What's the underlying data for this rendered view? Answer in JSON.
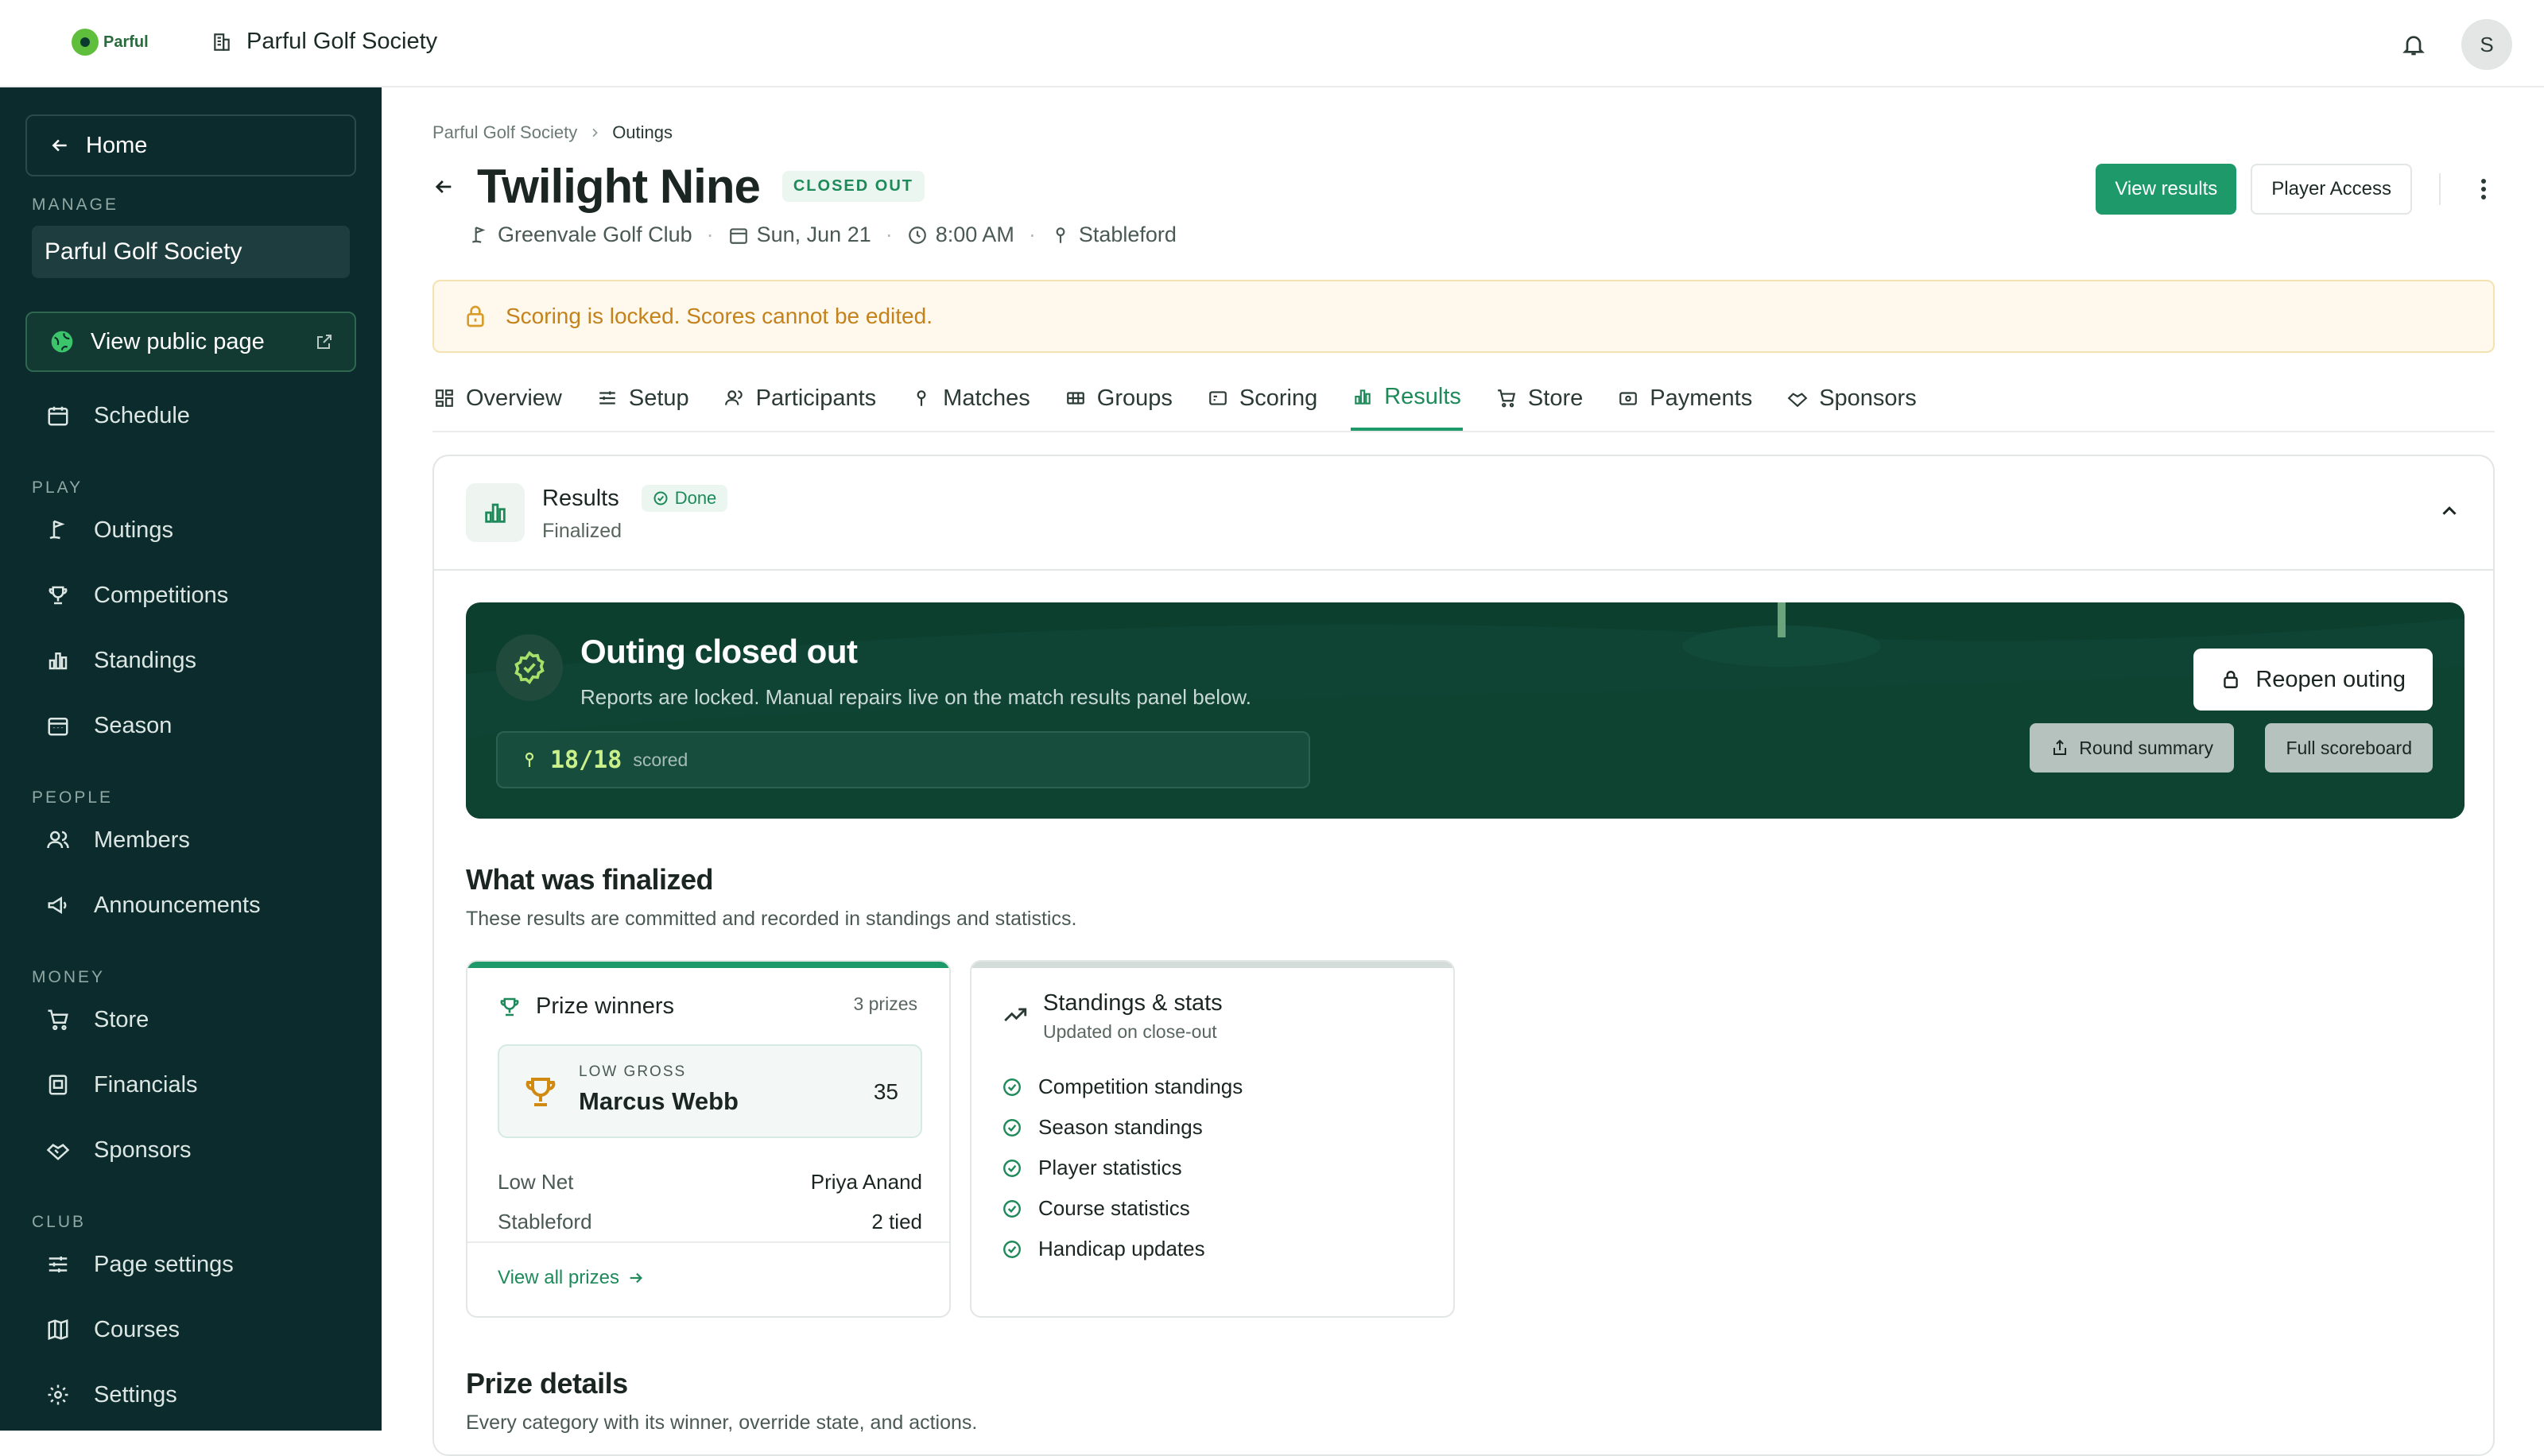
{
  "topbar": {
    "logo_text": "Parful",
    "org_name": "Parful Golf Society",
    "avatar_initial": "S"
  },
  "sidebar": {
    "home_label": "Home",
    "manage_label": "MANAGE",
    "org_item": "Parful Golf Society",
    "public_page_label": "View public page",
    "schedule": "Schedule",
    "play_label": "PLAY",
    "outings": "Outings",
    "competitions": "Competitions",
    "standings": "Standings",
    "season": "Season",
    "people_label": "PEOPLE",
    "members": "Members",
    "announcements": "Announcements",
    "money_label": "MONEY",
    "store": "Store",
    "financials": "Financials",
    "sponsors": "Sponsors",
    "club_label": "CLUB",
    "page_settings": "Page settings",
    "courses": "Courses",
    "settings": "Settings"
  },
  "breadcrumb": {
    "root": "Parful Golf Society",
    "current": "Outings"
  },
  "header": {
    "title": "Twilight Nine",
    "status": "CLOSED OUT",
    "course": "Greenvale Golf Club",
    "date": "Sun, Jun 21",
    "time": "8:00 AM",
    "format": "Stableford",
    "view_results": "View results",
    "player_access": "Player Access"
  },
  "banner": {
    "text": "Scoring is locked. Scores cannot be edited."
  },
  "tabs": {
    "overview": "Overview",
    "setup": "Setup",
    "participants": "Participants",
    "matches": "Matches",
    "groups": "Groups",
    "scoring": "Scoring",
    "results": "Results",
    "store": "Store",
    "payments": "Payments",
    "sponsors": "Sponsors"
  },
  "results_card": {
    "title": "Results",
    "done": "Done",
    "subtitle": "Finalized"
  },
  "hero": {
    "title": "Outing closed out",
    "subtitle": "Reports are locked. Manual repairs live on the match results panel below.",
    "scored_count": "18/18",
    "scored_label": "scored",
    "reopen": "Reopen outing",
    "round_summary": "Round summary",
    "full_scoreboard": "Full scoreboard"
  },
  "finalized": {
    "title": "What was finalized",
    "subtitle": "These results are committed and recorded in standings and statistics."
  },
  "prizes": {
    "title": "Prize winners",
    "count": "3 prizes",
    "top_category": "LOW GROSS",
    "top_winner": "Marcus Webb",
    "top_score": "35",
    "rows": [
      {
        "label": "Low Net",
        "value": "Priya Anand"
      },
      {
        "label": "Stableford",
        "value": "2 tied"
      }
    ],
    "view_all": "View all prizes"
  },
  "stats": {
    "title": "Standings & stats",
    "subtitle": "Updated on close-out",
    "items": [
      "Competition standings",
      "Season standings",
      "Player statistics",
      "Course statistics",
      "Handicap updates"
    ]
  },
  "prize_details": {
    "title": "Prize details",
    "subtitle": "Every category with its winner, override state, and actions."
  },
  "colors": {
    "primary": "#1e9a6a",
    "sidebar_bg": "#0c2b2d",
    "hero_bg": "#0d3f2f",
    "warning": "#c4821c"
  }
}
